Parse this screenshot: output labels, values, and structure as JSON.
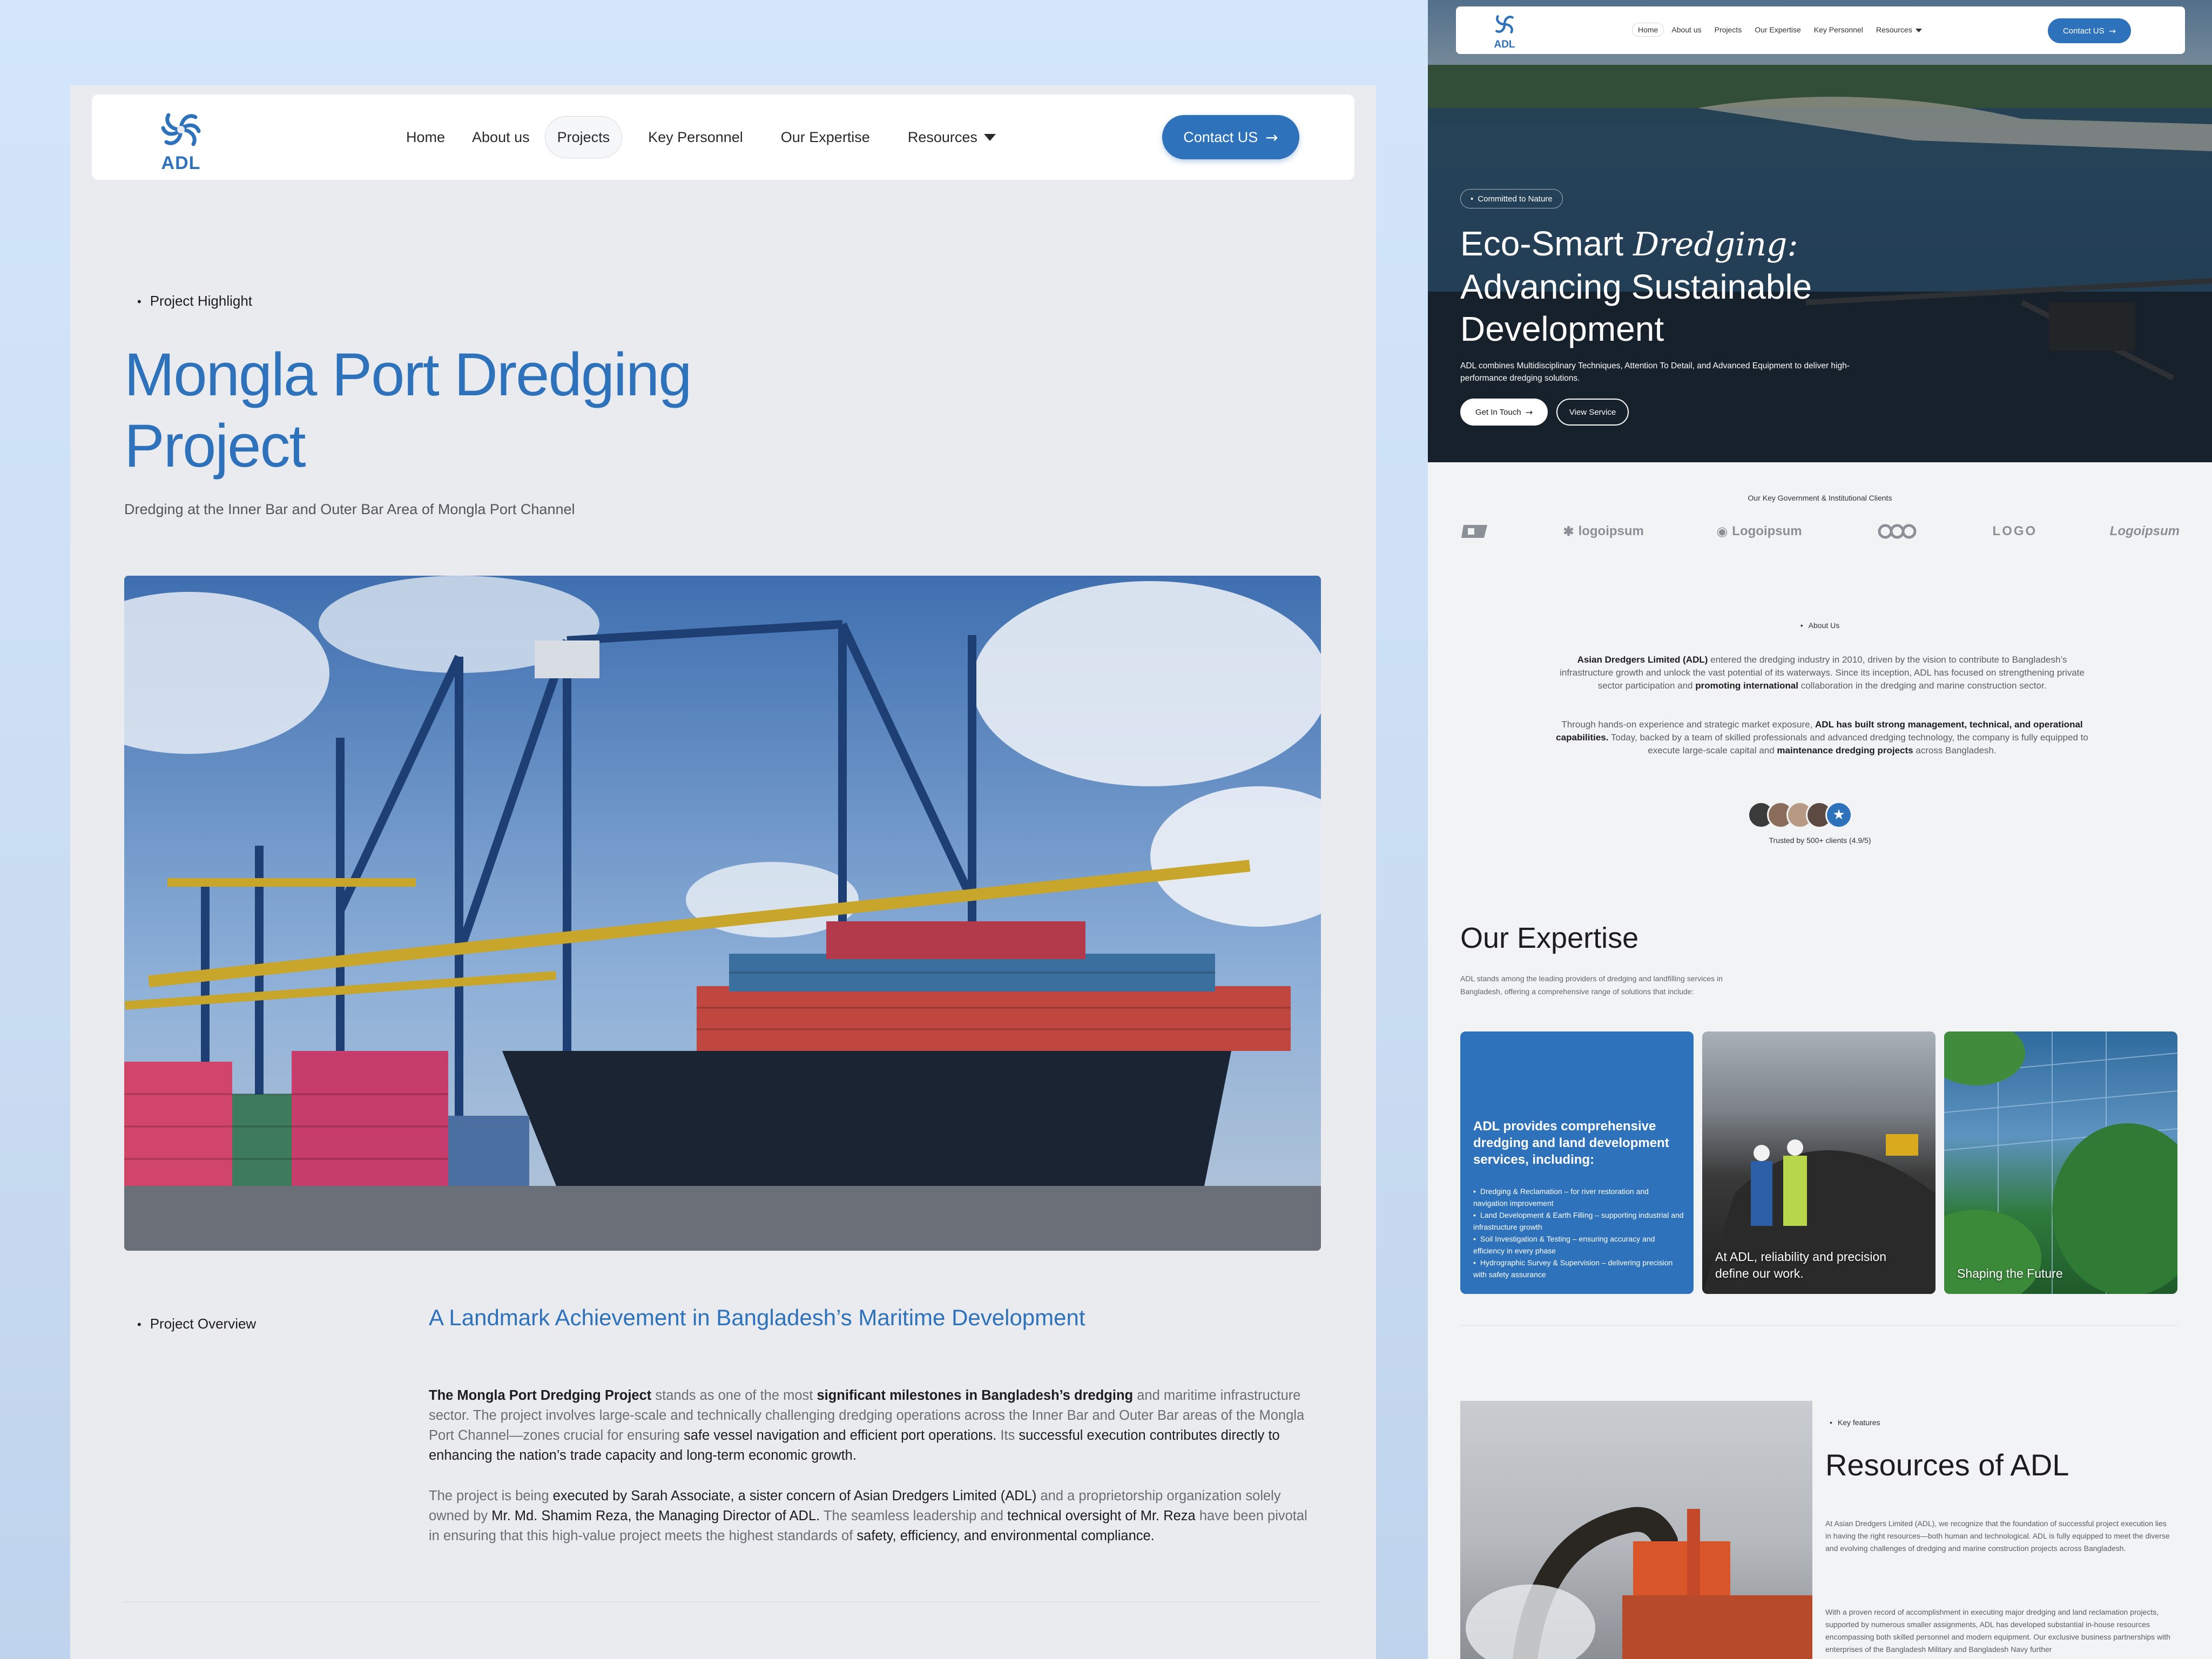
{
  "left": {
    "nav": {
      "logo_text": "ADL",
      "links": [
        "Home",
        "About us",
        "Projects",
        "Key Personnel",
        "Our Expertise",
        "Resources"
      ],
      "contact_label": "Contact US"
    },
    "highlight_label": "Project Highlight",
    "title": "Mongla Port Dredging Project",
    "subtitle": "Dredging at the Inner Bar and Outer Bar Area of Mongla Port Channel",
    "overview_label": "Project Overview",
    "overview_heading": "A Landmark Achievement in Bangladesh’s Maritime Development",
    "p1": {
      "b1": "The Mongla Port Dredging Project",
      "t1": " stands as one of the most ",
      "b2": "significant milestones in Bangladesh’s dredging",
      "t2": " and maritime infrastructure sector. The project involves large-scale and technically challenging dredging operations across the Inner Bar and Outer Bar areas of the Mongla Port Channel—zones crucial for ensuring ",
      "d1": "safe vessel navigation and efficient port operations.",
      "t3": " Its ",
      "d2": "successful execution contributes directly to enhancing the nation’s trade capacity and long-term economic growth."
    },
    "p2": {
      "t1": "The project is being ",
      "d1": "executed by Sarah Associate, a sister concern of Asian Dredgers Limited (ADL)",
      "t2": " and a proprietorship organization solely owned by ",
      "d2": "Mr. Md. Shamim Reza, the Managing Director of ADL.",
      "t3": " The seamless leadership and ",
      "d3": "technical oversight of Mr. Reza",
      "t4": " have been pivotal in ensuring that this high-value project meets the highest standards of ",
      "d4": "safety, efficiency, and environmental compliance."
    }
  },
  "right": {
    "nav": {
      "logo_text": "ADL",
      "links": [
        "Home",
        "About us",
        "Projects",
        "Our Expertise",
        "Key Personnel",
        "Resources"
      ],
      "contact_label": "Contact US"
    },
    "hero": {
      "tag": "Committed to Nature",
      "title_a": "Eco-Smart ",
      "title_italic": "Dredging:",
      "title_b": "Advancing Sustainable Development",
      "desc": "ADL combines Multidisciplinary Techniques, Attention To Detail, and Advanced Equipment to deliver high-performance dredging solutions.",
      "btn_primary": "Get In Touch",
      "btn_secondary": "View Service"
    },
    "clients_title": "Our Key Government & Institutional Clients",
    "client_logos": [
      "logoipsum",
      "Logoipsum",
      "LOGO",
      "Logoipsum"
    ],
    "about_label": "About Us",
    "about1": {
      "b1": "Asian Dredgers Limited (ADL)",
      "t1": " entered the dredging industry in 2010, driven by the vision to contribute to Bangladesh’s infrastructure growth and unlock the vast potential of its waterways. Since its inception, ADL has focused on strengthening private sector participation and ",
      "b2": "promoting international",
      "t2": " collaboration in the dredging and marine construction sector."
    },
    "about2": {
      "t1": "Through hands-on experience and strategic market exposure, ",
      "b1": "ADL has built strong management, technical, and operational capabilities.",
      "t2": " Today, backed by a team of skilled professionals and advanced dredging technology, the company is fully equipped to execute large-scale capital and ",
      "b2": "maintenance dredging projects",
      "t3": " across Bangladesh."
    },
    "trusted": "Trusted by 500+ clients (4.9/5)",
    "expertise": {
      "title": "Our Expertise",
      "desc": "ADL stands among the leading providers of dredging and landfilling services in Bangladesh, offering a comprehensive range of solutions that include:",
      "card_heading": "ADL provides comprehensive dredging and land development services, including:",
      "card_items": [
        "Dredging & Reclamation – for river restoration and navigation improvement",
        "Land Development & Earth Filling – supporting industrial and infrastructure growth",
        "Soil Investigation & Testing – ensuring accuracy and efficiency in every phase",
        "Hydrographic Survey & Supervision – delivering precision with safety assurance"
      ],
      "card2_caption": "At ADL, reliability and precision define our work.",
      "card3_caption": "Shaping the Future"
    },
    "resources": {
      "label": "Key features",
      "title": "Resources of ADL",
      "p1": "At Asian Dredgers Limited (ADL), we recognize that the foundation of successful project execution lies in having the right resources—both human and technological. ADL is fully equipped to meet the diverse and evolving challenges of dredging and marine construction projects across Bangladesh.",
      "p2": "With a proven record of accomplishment in executing major dredging and land reclamation projects, supported by numerous smaller assignments, ADL has developed substantial in-house resources encompassing both skilled personnel and modern equipment. Our exclusive business partnerships with enterprises of the Bangladesh Military and Bangladesh Navy further"
    }
  }
}
